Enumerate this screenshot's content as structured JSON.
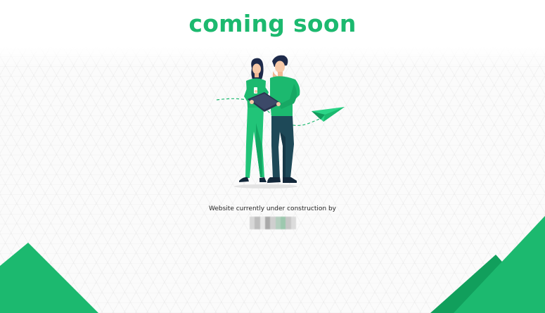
{
  "heading": "coming soon",
  "subtitle": "Website currently under construction by",
  "colors": {
    "accent": "#1cb96f",
    "accent_dark": "#0f9a58",
    "navy": "#1e4958",
    "text": "#222222"
  },
  "icons": {
    "hero": "people-laptop-illustration",
    "plane": "paper-plane-icon",
    "brand": "pixelated-logo"
  }
}
